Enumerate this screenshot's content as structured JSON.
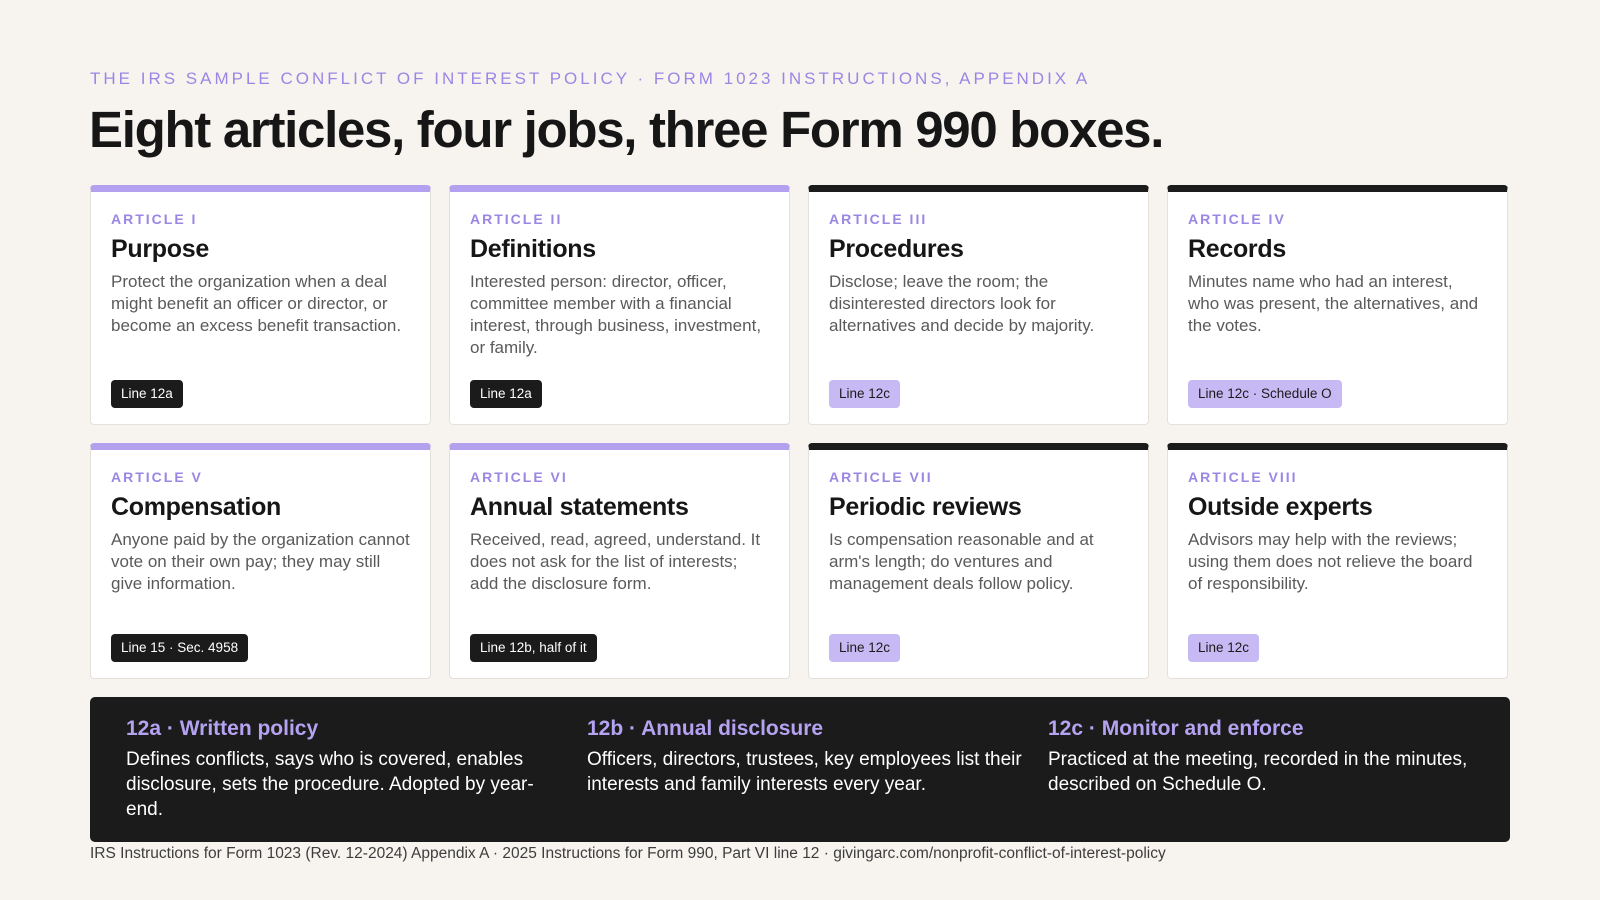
{
  "eyebrow": "THE IRS SAMPLE CONFLICT OF INTEREST POLICY · FORM 1023 INSTRUCTIONS, APPENDIX A",
  "headline": "Eight articles, four jobs, three Form 990 boxes.",
  "colors": {
    "background": "#f7f4f0",
    "accent_purple": "#9b86e3",
    "bar_purple": "#b3a1ef",
    "bar_black": "#1b1b1b",
    "tag_purple": "#c7b9f3",
    "panel": "#1b1b1b"
  },
  "articles": [
    {
      "number": "ARTICLE I",
      "title": "Purpose",
      "body": "Protect the organization when a deal might benefit an officer or director, or become an excess benefit transaction.",
      "tag": "Line 12a",
      "tag_style": "black",
      "bar_color": "purple"
    },
    {
      "number": "ARTICLE II",
      "title": "Definitions",
      "body": "Interested person: director, officer, committee member with a financial interest, through business, investment, or family.",
      "tag": "Line 12a",
      "tag_style": "black",
      "bar_color": "purple"
    },
    {
      "number": "ARTICLE III",
      "title": "Procedures",
      "body": "Disclose; leave the room; the disinterested directors look for alternatives and decide by majority.",
      "tag": "Line 12c",
      "tag_style": "purple",
      "bar_color": "black"
    },
    {
      "number": "ARTICLE IV",
      "title": "Records",
      "body": "Minutes name who had an interest, who was present, the alternatives, and the votes.",
      "tag": "Line 12c · Schedule O",
      "tag_style": "purple",
      "bar_color": "black"
    },
    {
      "number": "ARTICLE V",
      "title": "Compensation",
      "body": "Anyone paid by the organization cannot vote on their own pay; they may still give information.",
      "tag": "Line 15 · Sec. 4958",
      "tag_style": "black",
      "bar_color": "purple"
    },
    {
      "number": "ARTICLE VI",
      "title": "Annual statements",
      "body": "Received, read, agreed, understand. It does not ask for the list of interests; add the disclosure form.",
      "tag": "Line 12b, half of it",
      "tag_style": "black",
      "bar_color": "purple"
    },
    {
      "number": "ARTICLE VII",
      "title": "Periodic reviews",
      "body": "Is compensation reasonable and at arm's length; do ventures and management deals follow policy.",
      "tag": "Line 12c",
      "tag_style": "purple",
      "bar_color": "black"
    },
    {
      "number": "ARTICLE VIII",
      "title": "Outside experts",
      "body": "Advisors may help with the reviews; using them does not relieve the board of responsibility.",
      "tag": "Line 12c",
      "tag_style": "purple",
      "bar_color": "black"
    }
  ],
  "summary": [
    {
      "title": "12a · Written policy",
      "body": "Defines conflicts, says who is covered, enables disclosure, sets the procedure. Adopted by year-end."
    },
    {
      "title": "12b · Annual disclosure",
      "body": "Officers, directors, trustees, key employees list their interests and family interests every year."
    },
    {
      "title": "12c · Monitor and enforce",
      "body": "Practiced at the meeting, recorded in the minutes, described on Schedule O."
    }
  ],
  "footer": "IRS Instructions for Form 1023 (Rev. 12-2024) Appendix A · 2025 Instructions for Form 990, Part VI line 12 · givingarc.com/nonprofit-conflict-of-interest-policy"
}
